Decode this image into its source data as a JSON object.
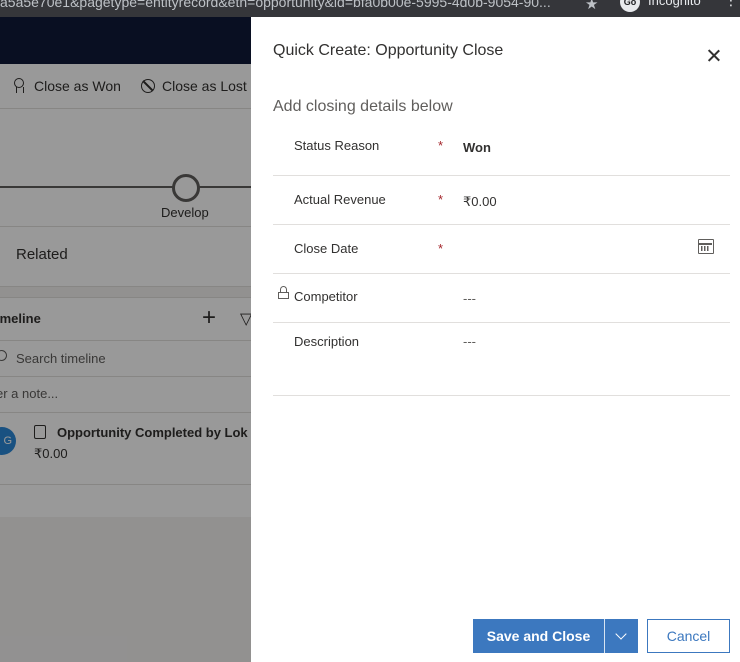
{
  "browser": {
    "url_fragment": "a5a5e70e1&pagetype=entityrecord&etn=opportunity&id=bfa0b00e-5995-4d0b-9054-90...",
    "profile_initials": "Go",
    "incognito_label": "Incognito"
  },
  "background_app": {
    "commands": {
      "close_won": "Close as Won",
      "close_lost": "Close as Lost"
    },
    "process_stage": "Develop",
    "related_tab": "Related",
    "timeline": {
      "header": "imeline",
      "search_placeholder": "Search timeline",
      "note_placeholder": "er a note...",
      "activity": {
        "avatar_initials": "G",
        "title": "Opportunity Completed by Lok",
        "amount": "₹0.00"
      }
    }
  },
  "dialog": {
    "title": "Quick Create: Opportunity Close",
    "subtitle": "Add closing details below",
    "fields": {
      "status_reason": {
        "label": "Status Reason",
        "required": "*",
        "value": "Won"
      },
      "actual_revenue": {
        "label": "Actual Revenue",
        "required": "*",
        "value": "₹0.00"
      },
      "close_date": {
        "label": "Close Date",
        "required": "*",
        "value": ""
      },
      "competitor": {
        "label": "Competitor",
        "value": "---"
      },
      "description": {
        "label": "Description",
        "value": "---"
      }
    },
    "buttons": {
      "save_and_close": "Save and Close",
      "cancel": "Cancel"
    }
  },
  "colors": {
    "primary": "#3c78bf",
    "required": "#a4262c",
    "navbar": "#0f1a3a"
  }
}
